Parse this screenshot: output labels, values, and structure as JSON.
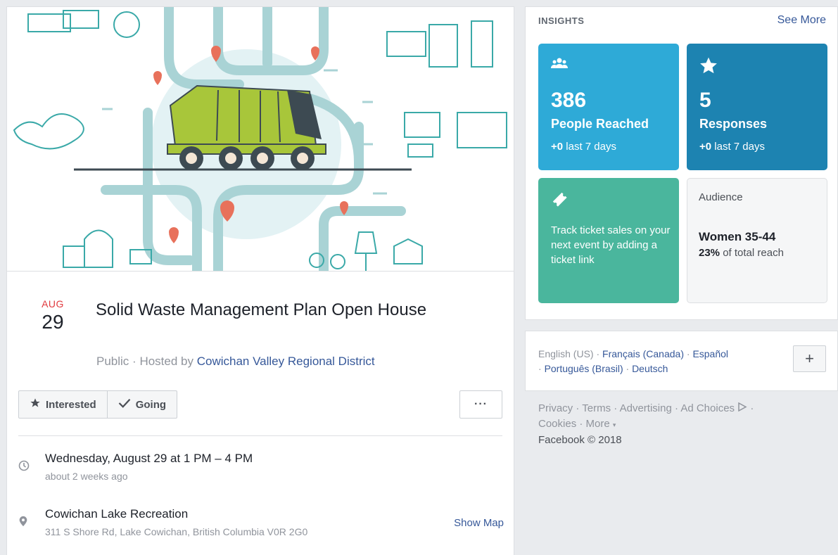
{
  "event": {
    "month": "AUG",
    "day": "29",
    "title": "Solid Waste Management Plan Open House",
    "privacy": "Public",
    "hosted_prefix": "Hosted by",
    "host": "Cowichan Valley Regional District",
    "buttons": {
      "interested": "Interested",
      "going": "Going",
      "more": "···"
    },
    "time": {
      "main": "Wednesday, August 29 at 1 PM – 4 PM",
      "sub": "about 2 weeks ago",
      "icon": "clock-icon"
    },
    "location": {
      "main": "Cowichan Lake Recreation",
      "sub": "311 S Shore Rd, Lake Cowichan, British Columbia V0R 2G0",
      "icon": "map-pin-icon",
      "show_map": "Show Map"
    }
  },
  "insights": {
    "heading": "INSIGHTS",
    "see_more": "See More",
    "reached": {
      "value": "386",
      "label": "People Reached",
      "delta": "+0",
      "period": "last 7 days",
      "icon": "people-icon",
      "color": "#2eaad7"
    },
    "responses": {
      "value": "5",
      "label": "Responses",
      "delta": "+0",
      "period": "last 7 days",
      "icon": "star-icon",
      "color": "#1d83b1"
    },
    "tickets": {
      "text": "Track ticket sales on your next event by adding a ticket link",
      "icon": "ticket-icon",
      "color": "#4ab69d"
    },
    "audience": {
      "label": "Audience",
      "segment": "Women 35-44",
      "percent": "23%",
      "suffix": "of total reach"
    }
  },
  "languages": {
    "current": "English (US)",
    "others": [
      "Français (Canada)",
      "Español",
      "Português (Brasil)",
      "Deutsch"
    ],
    "plus": "+"
  },
  "footer": {
    "links": [
      "Privacy",
      "Terms",
      "Advertising",
      "Ad Choices",
      "Cookies",
      "More"
    ],
    "copyright": "Facebook © 2018"
  }
}
